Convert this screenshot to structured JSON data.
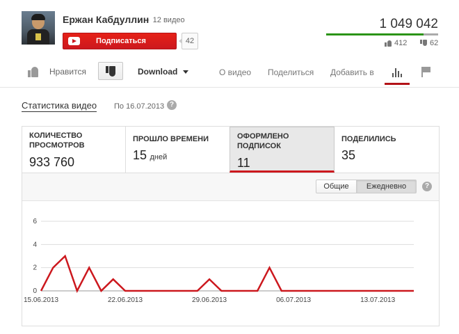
{
  "channel": {
    "name": "Ержан Кабдуллин",
    "video_count": "12 видео",
    "subscribe_label": "Подписаться",
    "subscriber_count": "42"
  },
  "video": {
    "views": "1 049 042",
    "likes": "412",
    "dislikes": "62",
    "like_ratio": 0.869
  },
  "actions": {
    "like_label": "Нравится",
    "download_label": "Download",
    "tabs": [
      "О видео",
      "Поделиться",
      "Добавить в"
    ]
  },
  "stats": {
    "title": "Статистика видео",
    "date": "По 16.07.2013",
    "help": "?",
    "metrics": [
      {
        "label": "Количество просмотров",
        "value": "933 760",
        "unit": ""
      },
      {
        "label": "Прошло времени",
        "value": "15",
        "unit": "дней"
      },
      {
        "label": "Оформлено подписок",
        "value": "11",
        "unit": ""
      },
      {
        "label": "Поделились",
        "value": "35",
        "unit": ""
      }
    ],
    "active_metric": 2,
    "toggle": {
      "total": "Общие",
      "daily": "Ежедневно",
      "selected": "Ежедневно"
    }
  },
  "colors": {
    "accent": "#cc181e",
    "like_green": "#2b9416"
  },
  "chart_data": {
    "type": "line",
    "x": [
      "15.06.2013",
      "16.06.2013",
      "17.06.2013",
      "18.06.2013",
      "19.06.2013",
      "20.06.2013",
      "21.06.2013",
      "22.06.2013",
      "23.06.2013",
      "24.06.2013",
      "25.06.2013",
      "26.06.2013",
      "27.06.2013",
      "28.06.2013",
      "29.06.2013",
      "30.06.2013",
      "01.07.2013",
      "02.07.2013",
      "03.07.2013",
      "04.07.2013",
      "05.07.2013",
      "06.07.2013",
      "07.07.2013",
      "08.07.2013",
      "09.07.2013",
      "10.07.2013",
      "11.07.2013",
      "12.07.2013",
      "13.07.2013",
      "14.07.2013",
      "15.07.2013",
      "16.07.2013"
    ],
    "series": [
      {
        "values": [
          0,
          2,
          3,
          0,
          2,
          0,
          1,
          0,
          0,
          0,
          0,
          0,
          0,
          0,
          1,
          0,
          0,
          0,
          0,
          2,
          0,
          0,
          0,
          0,
          0,
          0,
          0,
          0,
          0,
          0,
          0,
          0
        ],
        "color": "#cc181e"
      }
    ],
    "x_tick_labels": [
      "15.06.2013",
      "22.06.2013",
      "29.06.2013",
      "06.07.2013",
      "13.07.2013"
    ],
    "y_ticks": [
      0,
      2,
      4,
      6
    ],
    "ylim": [
      0,
      6
    ],
    "grid": true,
    "legend": "none"
  }
}
